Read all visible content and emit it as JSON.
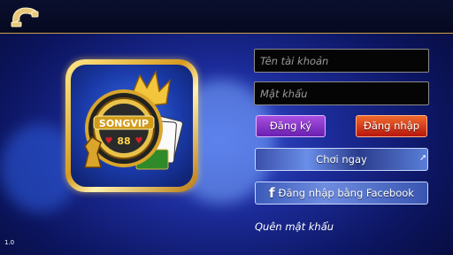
{
  "header": {
    "phone_icon": "phone-icon"
  },
  "logo": {
    "brand": "SONGVIP",
    "number": "88"
  },
  "login": {
    "username_placeholder": "Tên tài khoản",
    "password_placeholder": "Mật khẩu",
    "register_label": "Đăng ký",
    "login_label": "Đăng nhập",
    "play_now_label": "Chơi ngay",
    "facebook_label": "Đăng nhập bằng Facebook",
    "forgot_password": "Quên mật khẩu"
  },
  "version": "1.0",
  "colors": {
    "register": "#7a2fc8",
    "login": "#d9301c",
    "accent_gold": "#c9a24a",
    "background": "#1c2c9a"
  }
}
